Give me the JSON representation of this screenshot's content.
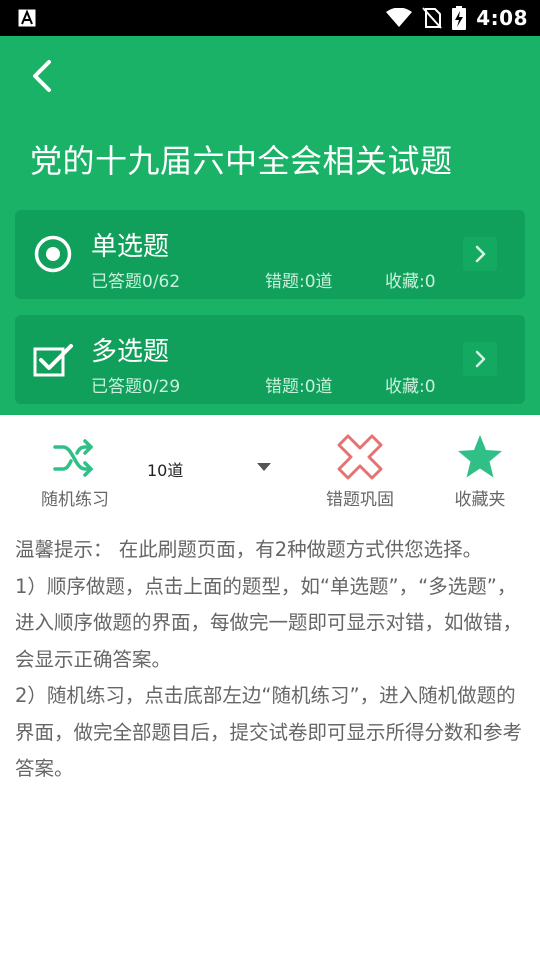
{
  "status_bar": {
    "time": "4:08",
    "icons": [
      "app-a-icon",
      "wifi-icon",
      "no-sim-icon",
      "battery-charging-icon"
    ]
  },
  "header": {
    "title": "党的十九届六中全会相关试题",
    "back_icon": "back-arrow-icon"
  },
  "cards": [
    {
      "title": "单选题",
      "icon": "radio-target-icon",
      "answered": "已答题0/62",
      "wrong": "错题:0道",
      "favorites": "收藏:0"
    },
    {
      "title": "多选题",
      "icon": "checkbox-checked-icon",
      "answered": "已答题0/29",
      "wrong": "错题:0道",
      "favorites": "收藏:0"
    }
  ],
  "toolbar": {
    "random_label": "随机练习",
    "count_value": "10道",
    "wrong_label": "错题巩固",
    "favorites_label": "收藏夹"
  },
  "tips": {
    "line1": "温馨提示： 在此刷题页面，有2种做题方式供您选择。",
    "line2": "1）顺序做题，点击上面的题型，如“单选题”，“多选题”，进入顺序做题的界面，每做完一题即可显示对错，如做错，会显示正确答案。",
    "line3": "2）随机练习，点击底部左边“随机练习”，进入随机做题的界面，做完全部题目后，提交试卷即可显示所得分数和参考答案。"
  },
  "colors": {
    "primary_green": "#19b267",
    "card_green": "#11a05b",
    "wrong_red": "#e57373",
    "star_green": "#2fbf87"
  }
}
